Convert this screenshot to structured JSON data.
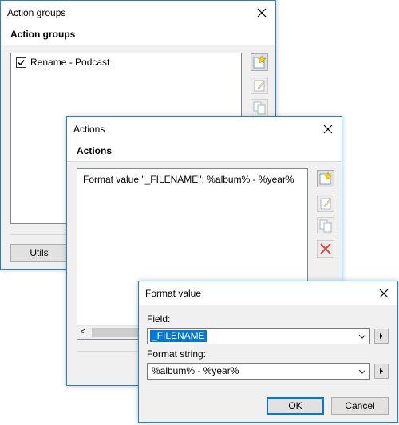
{
  "action_groups": {
    "title": "Action groups",
    "header": "Action groups",
    "items": [
      {
        "label": "Rename - Podcast",
        "checked": true
      }
    ],
    "utils_label": "Utils"
  },
  "actions": {
    "title": "Actions",
    "header": "Actions",
    "items": [
      {
        "label": "Format value \"_FILENAME\": %album% - %year%"
      }
    ],
    "scroll_left_glyph": "<"
  },
  "format_value": {
    "title": "Format value",
    "field_label": "Field:",
    "field_value": "_FILENAME",
    "format_label": "Format string:",
    "format_value": "%album% - %year%",
    "ok_label": "OK",
    "cancel_label": "Cancel"
  },
  "icons": {
    "new": "star-new-icon",
    "edit": "edit-icon",
    "copy": "copy-icon",
    "delete": "delete-icon",
    "close": "close-icon",
    "dropdown": "chevron-down-icon",
    "arrow": "play-arrow-icon"
  },
  "colors": {
    "accent": "#0078d7",
    "window_border": "#1883d7",
    "delete_red": "#e04343",
    "star_yellow": "#f5d31a"
  }
}
